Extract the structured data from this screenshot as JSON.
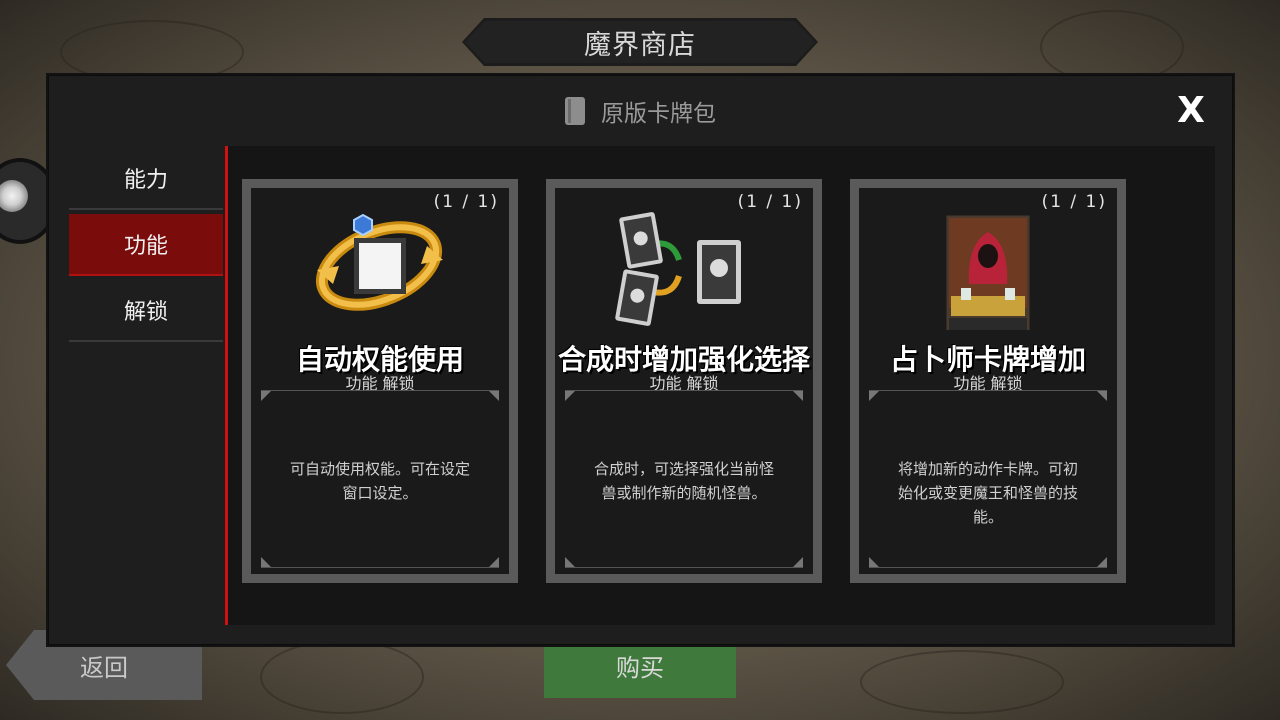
{
  "shop_title": "魔界商店",
  "modal": {
    "header_icon": "book-icon",
    "header_title": "原版卡牌包",
    "close_label": "X"
  },
  "sidebar": {
    "items": [
      {
        "label": "能力",
        "active": false
      },
      {
        "label": "功能",
        "active": true
      },
      {
        "label": "解锁",
        "active": false
      }
    ]
  },
  "cards": [
    {
      "count": "(1 / 1)",
      "title": "自动权能使用",
      "subtitle": "功能 解锁",
      "description": "可自动使用权能。可在设定窗口设定。",
      "icon": "auto-cycle-icon"
    },
    {
      "count": "(1 / 1)",
      "title": "合成时增加强化选择",
      "subtitle": "功能 解锁",
      "description": "合成时，可选择强化当前怪兽或制作新的随机怪兽。",
      "icon": "merge-cards-icon"
    },
    {
      "count": "(1 / 1)",
      "title": "占卜师卡牌增加",
      "subtitle": "功能 解锁",
      "description": "将增加新的动作卡牌。可初始化或变更魔王和怪兽的技能。",
      "icon": "fortune-teller-portrait"
    }
  ],
  "footer": {
    "back_label": "返回",
    "buy_label": "购买"
  },
  "colors": {
    "active_tab": "#7a0c0c",
    "accent_line": "#d11010",
    "buy_button": "#3f7a3c"
  }
}
